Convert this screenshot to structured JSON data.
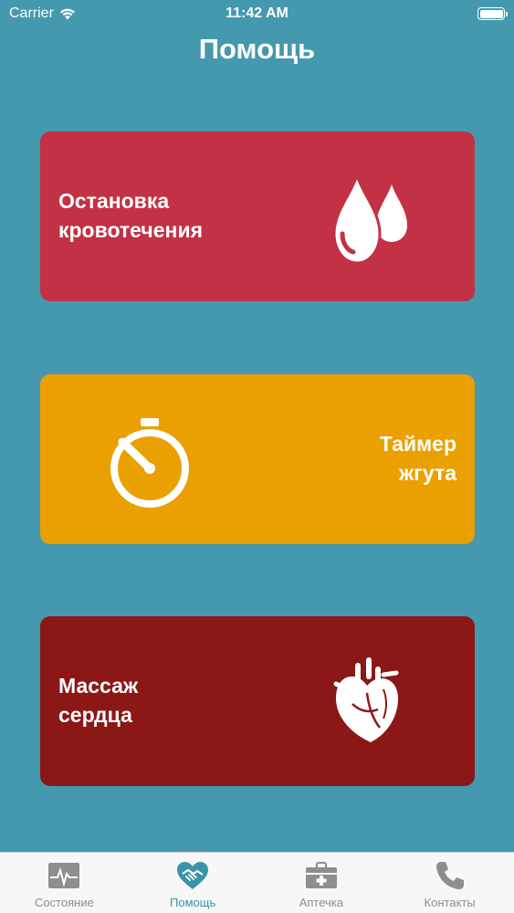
{
  "status_bar": {
    "carrier": "Carrier",
    "time": "11:42 AM"
  },
  "header": {
    "title": "Помощь"
  },
  "cards": {
    "bleeding": {
      "label": "Остановка\nкровотечения",
      "icon": "blood-drops-icon",
      "color": "#C23244"
    },
    "timer": {
      "label": "Таймер\nжгута",
      "icon": "stopwatch-icon",
      "color": "#EAA000"
    },
    "heart": {
      "label": "Массаж\nсердца",
      "icon": "heart-icon",
      "color": "#8C1717"
    }
  },
  "tab_bar": {
    "active_color": "#3A93A8",
    "items": [
      {
        "label": "Состояние",
        "icon": "heartbeat-monitor-icon"
      },
      {
        "label": "Помощь",
        "icon": "heart-handshake-icon",
        "active": true
      },
      {
        "label": "Аптечка",
        "icon": "first-aid-kit-icon"
      },
      {
        "label": "Контакты",
        "icon": "phone-icon"
      }
    ]
  }
}
